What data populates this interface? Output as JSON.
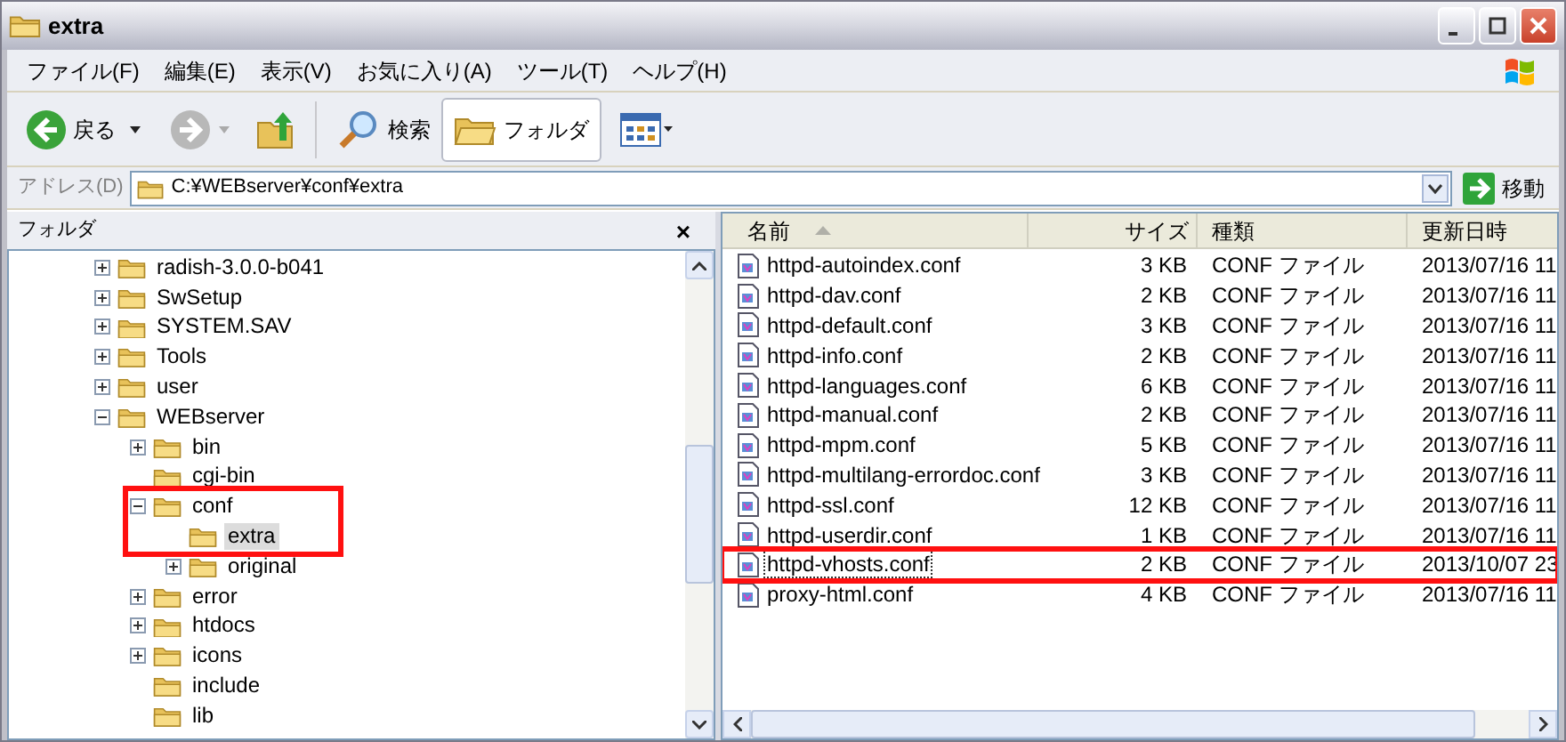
{
  "window": {
    "title": "extra"
  },
  "menu": [
    "ファイル(F)",
    "編集(E)",
    "表示(V)",
    "お気に入り(A)",
    "ツール(T)",
    "ヘルプ(H)"
  ],
  "toolbar": {
    "back": {
      "label": "戻る",
      "disabled": false
    },
    "forward": {
      "disabled": true
    },
    "search": {
      "label": "検索"
    },
    "folders": {
      "label": "フォルダ",
      "selected": true
    }
  },
  "address": {
    "label": "アドレス(D)",
    "value": "C:¥WEBserver¥conf¥extra",
    "go": "移動"
  },
  "folder_pane": {
    "title": "フォルダ",
    "close": "×",
    "tree": [
      {
        "name": "radish-3.0.0-b041",
        "expandable": true,
        "expanded": false,
        "selected": false,
        "annotated": false
      },
      {
        "name": "SwSetup",
        "expandable": true,
        "expanded": false,
        "selected": false,
        "annotated": false
      },
      {
        "name": "SYSTEM.SAV",
        "expandable": true,
        "expanded": false,
        "selected": false,
        "annotated": false
      },
      {
        "name": "Tools",
        "expandable": true,
        "expanded": false,
        "selected": false,
        "annotated": false
      },
      {
        "name": "user",
        "expandable": true,
        "expanded": false,
        "selected": false,
        "annotated": false
      },
      {
        "name": "WEBserver",
        "expandable": true,
        "expanded": true,
        "selected": false,
        "annotated": false,
        "children": [
          {
            "name": "bin",
            "expandable": true,
            "expanded": false,
            "selected": false,
            "annotated": false
          },
          {
            "name": "cgi-bin",
            "expandable": false,
            "selected": false,
            "annotated": false
          },
          {
            "name": "conf",
            "expandable": true,
            "expanded": true,
            "selected": false,
            "annotated": true,
            "children": [
              {
                "name": "extra",
                "expandable": false,
                "selected": true,
                "annotated": true
              },
              {
                "name": "original",
                "expandable": true,
                "expanded": false,
                "selected": false,
                "annotated": false
              }
            ]
          },
          {
            "name": "error",
            "expandable": true,
            "expanded": false,
            "selected": false,
            "annotated": false
          },
          {
            "name": "htdocs",
            "expandable": true,
            "expanded": false,
            "selected": false,
            "annotated": false
          },
          {
            "name": "icons",
            "expandable": true,
            "expanded": false,
            "selected": false,
            "annotated": false
          },
          {
            "name": "include",
            "expandable": false,
            "selected": false,
            "annotated": false
          },
          {
            "name": "lib",
            "expandable": false,
            "selected": false,
            "annotated": false
          }
        ]
      }
    ]
  },
  "file_list": {
    "columns": [
      "名前",
      "サイズ",
      "種類",
      "更新日時"
    ],
    "rows": [
      {
        "name": "httpd-autoindex.conf",
        "size": "3 KB",
        "type": "CONF ファイル",
        "modified": "2013/07/16 11",
        "focused": false,
        "annotated": false
      },
      {
        "name": "httpd-dav.conf",
        "size": "2 KB",
        "type": "CONF ファイル",
        "modified": "2013/07/16 11",
        "focused": false,
        "annotated": false
      },
      {
        "name": "httpd-default.conf",
        "size": "3 KB",
        "type": "CONF ファイル",
        "modified": "2013/07/16 11",
        "focused": false,
        "annotated": false
      },
      {
        "name": "httpd-info.conf",
        "size": "2 KB",
        "type": "CONF ファイル",
        "modified": "2013/07/16 11",
        "focused": false,
        "annotated": false
      },
      {
        "name": "httpd-languages.conf",
        "size": "6 KB",
        "type": "CONF ファイル",
        "modified": "2013/07/16 11",
        "focused": false,
        "annotated": false
      },
      {
        "name": "httpd-manual.conf",
        "size": "2 KB",
        "type": "CONF ファイル",
        "modified": "2013/07/16 11",
        "focused": false,
        "annotated": false
      },
      {
        "name": "httpd-mpm.conf",
        "size": "5 KB",
        "type": "CONF ファイル",
        "modified": "2013/07/16 11",
        "focused": false,
        "annotated": false
      },
      {
        "name": "httpd-multilang-errordoc.conf",
        "size": "3 KB",
        "type": "CONF ファイル",
        "modified": "2013/07/16 11",
        "focused": false,
        "annotated": false
      },
      {
        "name": "httpd-ssl.conf",
        "size": "12 KB",
        "type": "CONF ファイル",
        "modified": "2013/07/16 11",
        "focused": false,
        "annotated": false
      },
      {
        "name": "httpd-userdir.conf",
        "size": "1 KB",
        "type": "CONF ファイル",
        "modified": "2013/07/16 11",
        "focused": false,
        "annotated": false
      },
      {
        "name": "httpd-vhosts.conf",
        "size": "2 KB",
        "type": "CONF ファイル",
        "modified": "2013/10/07 23",
        "focused": true,
        "annotated": true
      },
      {
        "name": "proxy-html.conf",
        "size": "4 KB",
        "type": "CONF ファイル",
        "modified": "2013/07/16 11",
        "focused": false,
        "annotated": false
      }
    ]
  }
}
